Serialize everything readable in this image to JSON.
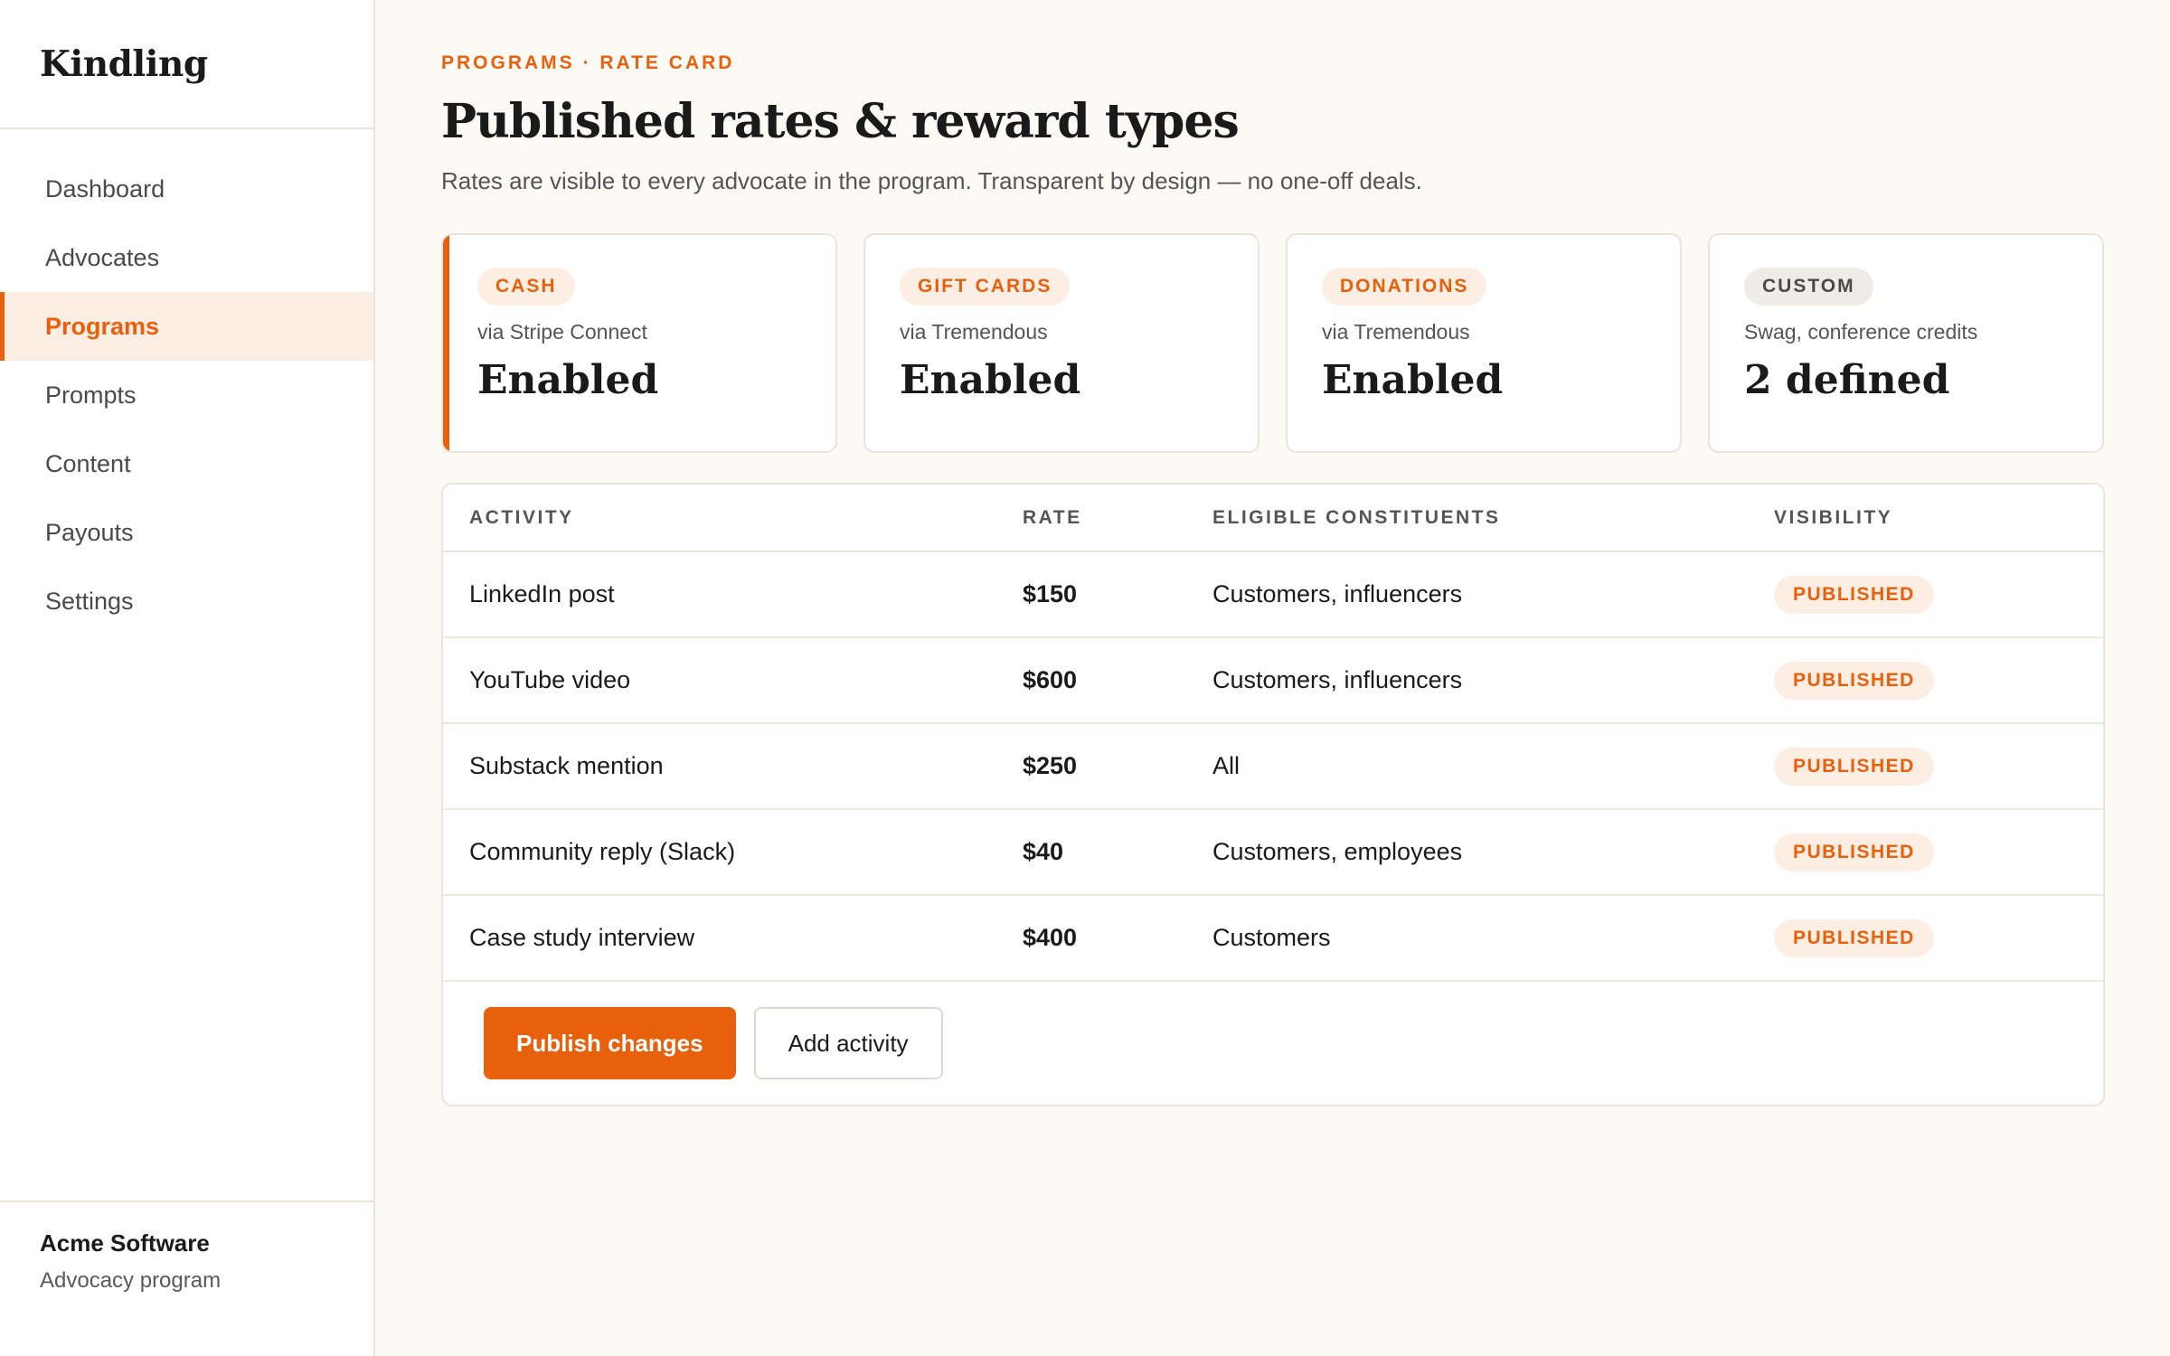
{
  "app": {
    "brand": "Kindling"
  },
  "sidebar": {
    "items": [
      {
        "label": "Dashboard",
        "active": false
      },
      {
        "label": "Advocates",
        "active": false
      },
      {
        "label": "Programs",
        "active": true
      },
      {
        "label": "Prompts",
        "active": false
      },
      {
        "label": "Content",
        "active": false
      },
      {
        "label": "Payouts",
        "active": false
      },
      {
        "label": "Settings",
        "active": false
      }
    ],
    "org": {
      "name": "Acme Software",
      "subtitle": "Advocacy program"
    }
  },
  "header": {
    "breadcrumb": "PROGRAMS · RATE CARD",
    "title": "Published rates & reward types",
    "subtitle": "Rates are visible to every advocate in the program. Transparent by design — no one-off deals."
  },
  "cards": [
    {
      "tag": "CASH",
      "via": "via Stripe Connect",
      "value": "Enabled"
    },
    {
      "tag": "GIFT CARDS",
      "via": "via Tremendous",
      "value": "Enabled"
    },
    {
      "tag": "DONATIONS",
      "via": "via Tremendous",
      "value": "Enabled"
    },
    {
      "tag": "CUSTOM",
      "via": "Swag, conference credits",
      "value": "2 defined"
    }
  ],
  "table": {
    "columns": [
      "ACTIVITY",
      "RATE",
      "ELIGIBLE CONSTITUENTS",
      "VISIBILITY"
    ],
    "rows": [
      {
        "activity": "LinkedIn post",
        "rate": "$150",
        "eligible": "Customers, influencers",
        "visibility": "PUBLISHED"
      },
      {
        "activity": "YouTube video",
        "rate": "$600",
        "eligible": "Customers, influencers",
        "visibility": "PUBLISHED"
      },
      {
        "activity": "Substack mention",
        "rate": "$250",
        "eligible": "All",
        "visibility": "PUBLISHED"
      },
      {
        "activity": "Community reply (Slack)",
        "rate": "$40",
        "eligible": "Customers, employees",
        "visibility": "PUBLISHED"
      },
      {
        "activity": "Case study interview",
        "rate": "$400",
        "eligible": "Customers",
        "visibility": "PUBLISHED"
      }
    ]
  },
  "actions": {
    "publish_label": "Publish changes",
    "add_label": "Add activity"
  },
  "colors": {
    "accent": "#e8600c",
    "accent_soft": "#fdeee4",
    "background": "#fdfaf6"
  }
}
